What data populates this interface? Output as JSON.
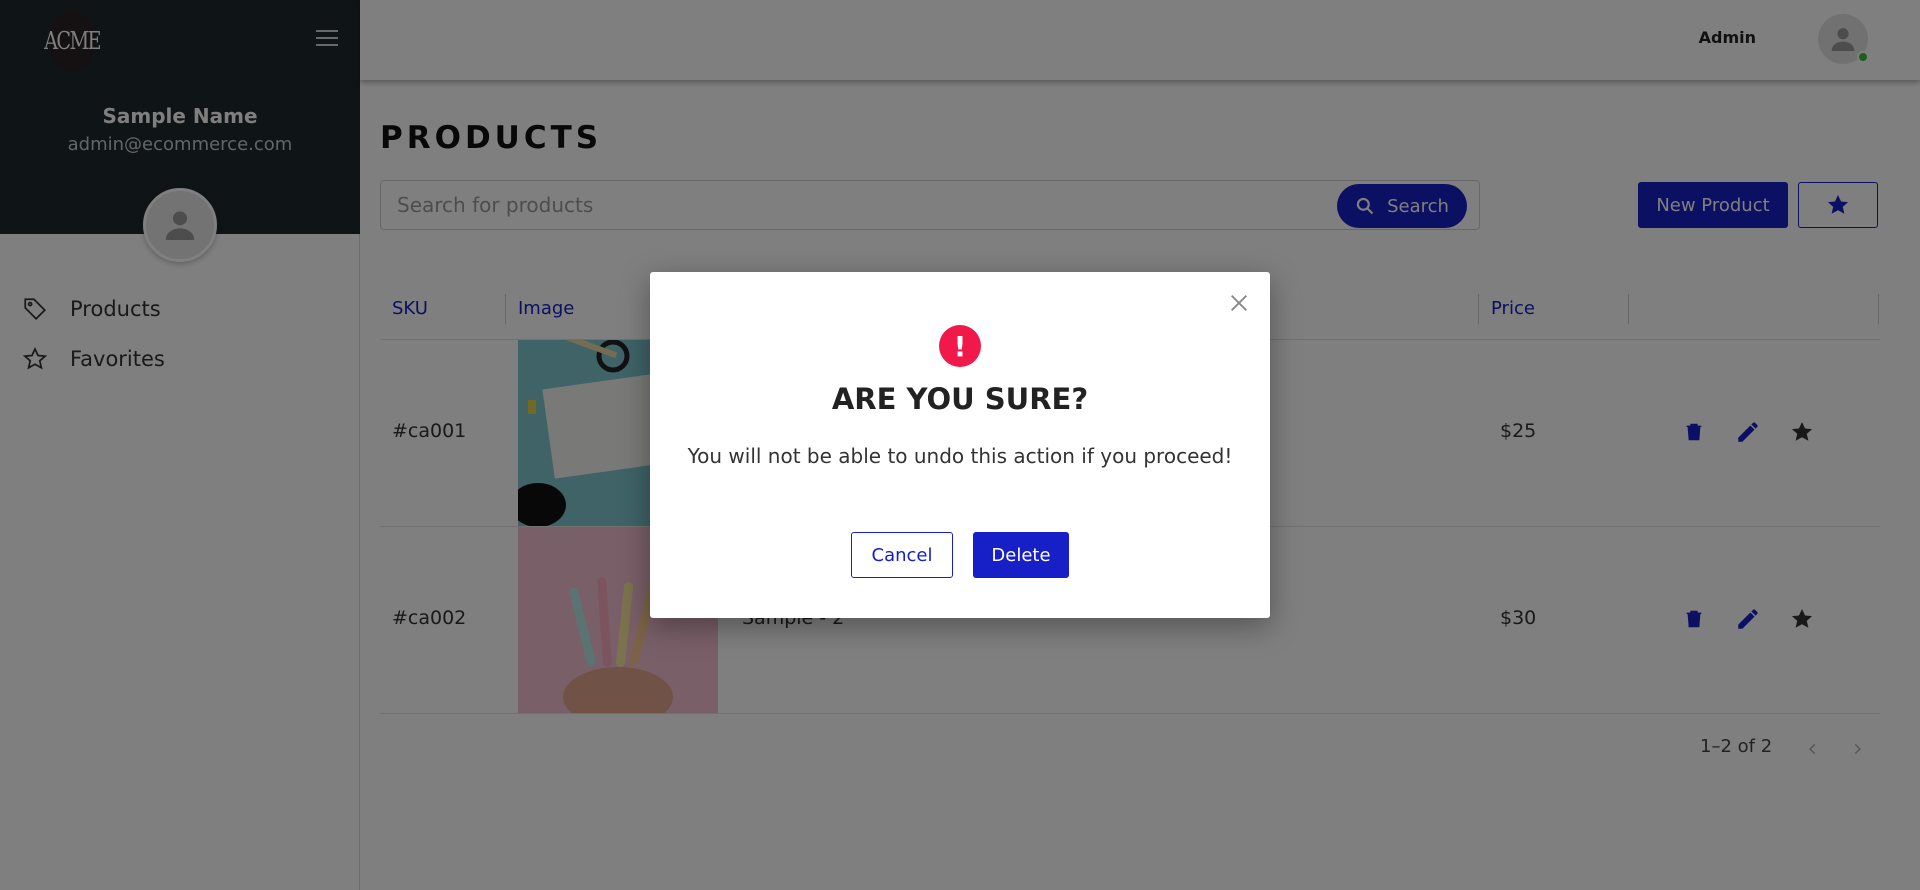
{
  "brand": {
    "logo_text": "ACME"
  },
  "sidebar": {
    "user_name": "Sample Name",
    "user_email": "admin@ecommerce.com",
    "items": [
      {
        "label": "Products",
        "icon": "tag-icon"
      },
      {
        "label": "Favorites",
        "icon": "star-outline-icon"
      }
    ]
  },
  "header": {
    "role": "Admin",
    "online": true
  },
  "main": {
    "title": "PRODUCTS",
    "search": {
      "placeholder": "Search for products",
      "value": "",
      "button_label": "Search"
    },
    "new_product_label": "New Product",
    "table": {
      "columns": [
        "SKU",
        "Image",
        "",
        "Price",
        ""
      ],
      "rows": [
        {
          "sku": "#ca001",
          "name": "",
          "price": "$25",
          "image": "stationery-flatlay-image"
        },
        {
          "sku": "#ca002",
          "name": "Sample - 2",
          "price": "$30",
          "image": "pastel-markers-image"
        }
      ]
    },
    "pagination": {
      "label": "1–2 of 2"
    }
  },
  "modal": {
    "title": "ARE YOU SURE?",
    "message": "You will not be able to undo this action if you proceed!",
    "cancel_label": "Cancel",
    "delete_label": "Delete"
  },
  "colors": {
    "primary": "#1620c6",
    "sidebar_bg": "#1e2a2e",
    "alert": "#f0194a",
    "online": "#3bbf3b"
  }
}
